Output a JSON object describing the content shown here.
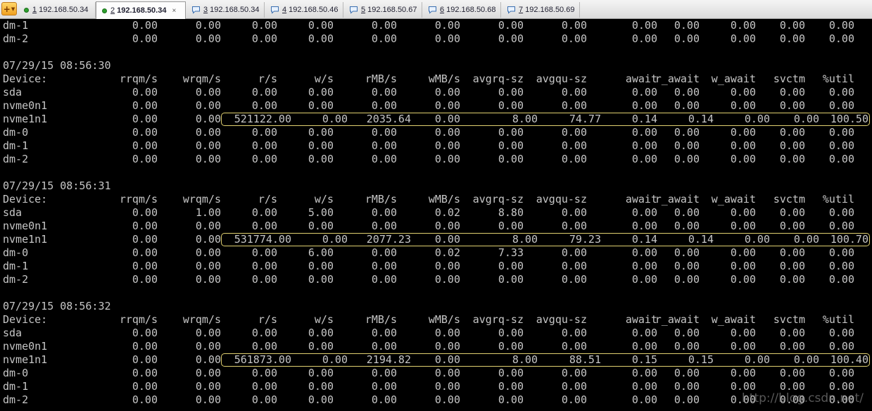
{
  "tabbar": {
    "tabs": [
      {
        "num": "1",
        "label": "192.168.50.34",
        "status": "connected"
      },
      {
        "num": "2",
        "label": "192.168.50.34",
        "status": "connected",
        "active": true
      },
      {
        "num": "3",
        "label": "192.168.50.34",
        "status": "chat"
      },
      {
        "num": "4",
        "label": "192.168.50.46",
        "status": "chat"
      },
      {
        "num": "5",
        "label": "192.168.50.67",
        "status": "chat"
      },
      {
        "num": "6",
        "label": "192.168.50.68",
        "status": "chat"
      },
      {
        "num": "7",
        "label": "192.168.50.69",
        "status": "chat"
      }
    ],
    "close_glyph": "×"
  },
  "terminal": {
    "columns": [
      "Device:",
      "rrqm/s",
      "wrqm/s",
      "r/s",
      "w/s",
      "rMB/s",
      "wMB/s",
      "avgrq-sz",
      "avgqu-sz",
      "await",
      "r_await",
      "w_await",
      "svctm",
      "%util"
    ],
    "top_rows": [
      [
        "dm-1",
        "0.00",
        "0.00",
        "0.00",
        "0.00",
        "0.00",
        "0.00",
        "0.00",
        "0.00",
        "0.00",
        "0.00",
        "0.00",
        "0.00",
        "0.00"
      ],
      [
        "dm-2",
        "0.00",
        "0.00",
        "0.00",
        "0.00",
        "0.00",
        "0.00",
        "0.00",
        "0.00",
        "0.00",
        "0.00",
        "0.00",
        "0.00",
        "0.00"
      ]
    ],
    "blocks": [
      {
        "timestamp": "07/29/15 08:56:30",
        "rows": [
          [
            "sda",
            "0.00",
            "0.00",
            "0.00",
            "0.00",
            "0.00",
            "0.00",
            "0.00",
            "0.00",
            "0.00",
            "0.00",
            "0.00",
            "0.00",
            "0.00"
          ],
          [
            "nvme0n1",
            "0.00",
            "0.00",
            "0.00",
            "0.00",
            "0.00",
            "0.00",
            "0.00",
            "0.00",
            "0.00",
            "0.00",
            "0.00",
            "0.00",
            "0.00"
          ],
          [
            "nvme1n1",
            "0.00",
            "0.00",
            "521122.00",
            "0.00",
            "2035.64",
            "0.00",
            "8.00",
            "74.77",
            "0.14",
            "0.14",
            "0.00",
            "0.00",
            "100.50"
          ],
          [
            "dm-0",
            "0.00",
            "0.00",
            "0.00",
            "0.00",
            "0.00",
            "0.00",
            "0.00",
            "0.00",
            "0.00",
            "0.00",
            "0.00",
            "0.00",
            "0.00"
          ],
          [
            "dm-1",
            "0.00",
            "0.00",
            "0.00",
            "0.00",
            "0.00",
            "0.00",
            "0.00",
            "0.00",
            "0.00",
            "0.00",
            "0.00",
            "0.00",
            "0.00"
          ],
          [
            "dm-2",
            "0.00",
            "0.00",
            "0.00",
            "0.00",
            "0.00",
            "0.00",
            "0.00",
            "0.00",
            "0.00",
            "0.00",
            "0.00",
            "0.00",
            "0.00"
          ]
        ],
        "highlight_row": 2
      },
      {
        "timestamp": "07/29/15 08:56:31",
        "rows": [
          [
            "sda",
            "0.00",
            "1.00",
            "0.00",
            "5.00",
            "0.00",
            "0.02",
            "8.80",
            "0.00",
            "0.00",
            "0.00",
            "0.00",
            "0.00",
            "0.00"
          ],
          [
            "nvme0n1",
            "0.00",
            "0.00",
            "0.00",
            "0.00",
            "0.00",
            "0.00",
            "0.00",
            "0.00",
            "0.00",
            "0.00",
            "0.00",
            "0.00",
            "0.00"
          ],
          [
            "nvme1n1",
            "0.00",
            "0.00",
            "531774.00",
            "0.00",
            "2077.23",
            "0.00",
            "8.00",
            "79.23",
            "0.14",
            "0.14",
            "0.00",
            "0.00",
            "100.70"
          ],
          [
            "dm-0",
            "0.00",
            "0.00",
            "0.00",
            "6.00",
            "0.00",
            "0.02",
            "7.33",
            "0.00",
            "0.00",
            "0.00",
            "0.00",
            "0.00",
            "0.00"
          ],
          [
            "dm-1",
            "0.00",
            "0.00",
            "0.00",
            "0.00",
            "0.00",
            "0.00",
            "0.00",
            "0.00",
            "0.00",
            "0.00",
            "0.00",
            "0.00",
            "0.00"
          ],
          [
            "dm-2",
            "0.00",
            "0.00",
            "0.00",
            "0.00",
            "0.00",
            "0.00",
            "0.00",
            "0.00",
            "0.00",
            "0.00",
            "0.00",
            "0.00",
            "0.00"
          ]
        ],
        "highlight_row": 2
      },
      {
        "timestamp": "07/29/15 08:56:32",
        "rows": [
          [
            "sda",
            "0.00",
            "0.00",
            "0.00",
            "0.00",
            "0.00",
            "0.00",
            "0.00",
            "0.00",
            "0.00",
            "0.00",
            "0.00",
            "0.00",
            "0.00"
          ],
          [
            "nvme0n1",
            "0.00",
            "0.00",
            "0.00",
            "0.00",
            "0.00",
            "0.00",
            "0.00",
            "0.00",
            "0.00",
            "0.00",
            "0.00",
            "0.00",
            "0.00"
          ],
          [
            "nvme1n1",
            "0.00",
            "0.00",
            "561873.00",
            "0.00",
            "2194.82",
            "0.00",
            "8.00",
            "88.51",
            "0.15",
            "0.15",
            "0.00",
            "0.00",
            "100.40"
          ],
          [
            "dm-0",
            "0.00",
            "0.00",
            "0.00",
            "0.00",
            "0.00",
            "0.00",
            "0.00",
            "0.00",
            "0.00",
            "0.00",
            "0.00",
            "0.00",
            "0.00"
          ],
          [
            "dm-1",
            "0.00",
            "0.00",
            "0.00",
            "0.00",
            "0.00",
            "0.00",
            "0.00",
            "0.00",
            "0.00",
            "0.00",
            "0.00",
            "0.00",
            "0.00"
          ],
          [
            "dm-2",
            "0.00",
            "0.00",
            "0.00",
            "0.00",
            "0.00",
            "0.00",
            "0.00",
            "0.00",
            "0.00",
            "0.00",
            "0.00",
            "0.00",
            "0.00"
          ]
        ],
        "highlight_row": 2
      }
    ]
  },
  "watermark": "http://blog.csdn.net/",
  "colors": {
    "background": "#000000",
    "text": "#c6c6c6",
    "highlight_border": "#e0d070",
    "status_dot": "#2ea02e"
  }
}
